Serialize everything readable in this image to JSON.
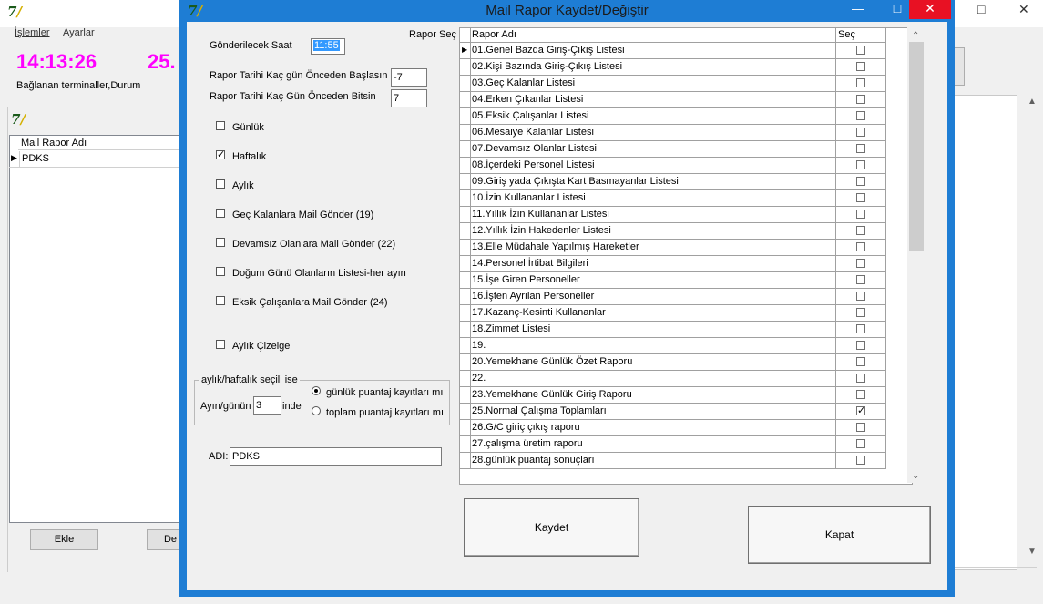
{
  "bg": {
    "menu": [
      "İşlemler",
      "Ayarlar"
    ],
    "clock": "14:13:26",
    "date": "25.",
    "connection_label": "Bağlanan terminaller,Durum",
    "child": {
      "list_header": "Mail Rapor Adı",
      "rows": [
        "PDKS"
      ],
      "add_button": "Ekle",
      "edit_button_partial": "De"
    }
  },
  "dialog": {
    "title": "Mail Rapor Kaydet/Değiştir",
    "send_time_label": "Gönderilecek Saat",
    "send_time_value": "11:55",
    "start_days_label": "Rapor Tarihi Kaç gün Önceden Başlasın",
    "start_days_value": "-7",
    "end_days_label": "Rapor Tarihi Kaç Gün Önceden Bitsin",
    "end_days_value": "7",
    "options": [
      {
        "label": "Günlük",
        "checked": false
      },
      {
        "label": "Haftalık",
        "checked": true
      },
      {
        "label": "Aylık",
        "checked": false
      },
      {
        "label": "Geç Kalanlara Mail Gönder (19)",
        "checked": false
      },
      {
        "label": "Devamsız Olanlara Mail Gönder (22)",
        "checked": false
      },
      {
        "label": "Doğum Günü Olanların Listesi-her ayın",
        "checked": false
      },
      {
        "label": "Eksik Çalışanlara Mail Gönder (24)",
        "checked": false
      }
    ],
    "monthly_chart_label": "Aylık Çizelge",
    "group": {
      "title": "aylık/haftalık seçili ise",
      "day_label": "Ayın/günün",
      "day_value": "3",
      "day_suffix": "inde",
      "radio_daily": "günlük puantaj kayıtları mı",
      "radio_total": "toplam puantaj kayıtları mı",
      "selected": "daily"
    },
    "name_label": "ADI:",
    "name_value": "PDKS",
    "report_select_label": "Rapor Seç",
    "grid": {
      "col_name": "Rapor Adı",
      "col_select": "Seç",
      "rows": [
        {
          "name": "01.Genel Bazda Giriş-Çıkış Listesi",
          "checked": false
        },
        {
          "name": "02.Kişi Bazında Giriş-Çıkış Listesi",
          "checked": false
        },
        {
          "name": "03.Geç Kalanlar Listesi",
          "checked": false
        },
        {
          "name": "04.Erken Çıkanlar Listesi",
          "checked": false
        },
        {
          "name": "05.Eksik Çalışanlar Listesi",
          "checked": false
        },
        {
          "name": "06.Mesaiye Kalanlar Listesi",
          "checked": false
        },
        {
          "name": "07.Devamsız Olanlar Listesi",
          "checked": false
        },
        {
          "name": "08.İçerdeki Personel Listesi",
          "checked": false
        },
        {
          "name": "09.Giriş yada Çıkışta Kart Basmayanlar Listesi",
          "checked": false
        },
        {
          "name": "10.İzin Kullananlar Listesi",
          "checked": false
        },
        {
          "name": "11.Yıllık İzin Kullananlar Listesi",
          "checked": false
        },
        {
          "name": "12.Yıllık İzin Hakedenler Listesi",
          "checked": false
        },
        {
          "name": "13.Elle Müdahale Yapılmış Hareketler",
          "checked": false
        },
        {
          "name": "14.Personel İrtibat Bilgileri",
          "checked": false
        },
        {
          "name": "15.İşe Giren Personeller",
          "checked": false
        },
        {
          "name": "16.İşten Ayrılan Personeller",
          "checked": false
        },
        {
          "name": "17.Kazanç-Kesinti Kullananlar",
          "checked": false
        },
        {
          "name": "18.Zimmet Listesi",
          "checked": false
        },
        {
          "name": "19.",
          "checked": false
        },
        {
          "name": "20.Yemekhane Günlük Özet Raporu",
          "checked": false
        },
        {
          "name": "22.",
          "checked": false
        },
        {
          "name": "23.Yemekhane Günlük Giriş Raporu",
          "checked": false
        },
        {
          "name": "25.Normal Çalışma Toplamları",
          "checked": true
        },
        {
          "name": "26.G/C giriç çıkış raporu",
          "checked": false
        },
        {
          "name": "27.çalışma üretim raporu",
          "checked": false
        },
        {
          "name": "28.günlük puantaj sonuçları",
          "checked": false
        }
      ]
    },
    "save_button": "Kaydet",
    "close_button": "Kapat"
  },
  "colors": {
    "dialog_frame": "#1e7dd4",
    "clock": "#ff00ff",
    "close_red": "#e81123"
  }
}
